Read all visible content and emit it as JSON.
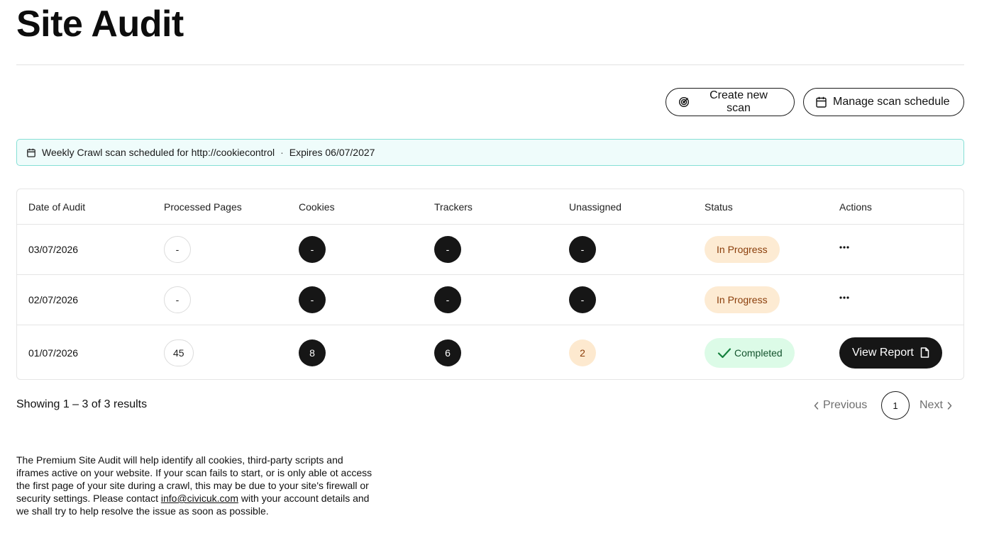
{
  "page": {
    "title": "Site Audit"
  },
  "actions": {
    "create_label": "Create new scan",
    "schedule_label": "Manage scan schedule"
  },
  "banner": {
    "text": "Weekly Crawl scan scheduled for http://cookiecontrol",
    "separator": "·",
    "expires": "Expires 06/07/2027"
  },
  "table": {
    "columns": [
      "Date of Audit",
      "Processed Pages",
      "Cookies",
      "Trackers",
      "Unassigned",
      "Status",
      "Actions"
    ],
    "rows": [
      {
        "date": "03/07/2026",
        "pages": "-",
        "cookies": "-",
        "trackers": "-",
        "unassigned": "-",
        "status": "In Progress",
        "action": "more"
      },
      {
        "date": "02/07/2026",
        "pages": "-",
        "cookies": "-",
        "trackers": "-",
        "unassigned": "-",
        "status": "In Progress",
        "action": "more"
      },
      {
        "date": "01/07/2026",
        "pages": "45",
        "cookies": "8",
        "trackers": "6",
        "unassigned": "2",
        "status": "Completed",
        "action": "View Report"
      }
    ]
  },
  "pagination": {
    "summary": "Showing 1 – 3 of 3 results",
    "previous": "Previous",
    "current_page": "1",
    "next": "Next"
  },
  "footer": {
    "text_before": "The Premium Site Audit will help identify all cookies, third-party scripts and iframes active on your website. If your scan fails to start, or is only able ot access the first page of your site during a crawl, this may be due to your site's firewall or security settings. Please contact ",
    "email": "info@civicuk.com",
    "text_after": " with your account details and we shall try to help resolve the issue as soon as possible."
  },
  "colors": {
    "primary_dark": "#161616",
    "banner_bg": "#effcfb",
    "banner_border": "#86dfd5",
    "progress_bg": "#fdebd3",
    "progress_text": "#8a3d0a",
    "complete_bg": "#dcfbe7",
    "complete_text": "#14532d"
  },
  "icons": {
    "create": "radar-icon",
    "schedule": "calendar-icon",
    "banner": "calendar-icon",
    "row_action": "ellipsis-icon",
    "completed": "check-icon",
    "view_report": "document-icon",
    "previous": "chevron-left-icon",
    "next": "chevron-right-icon"
  }
}
